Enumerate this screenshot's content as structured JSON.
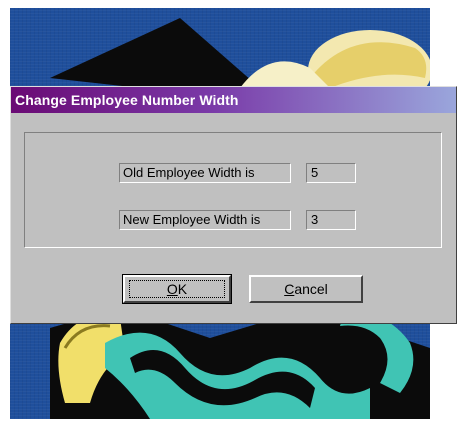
{
  "dialog": {
    "title": "Change Employee Number Width",
    "old_label": "Old Employee Width is",
    "old_value": "5",
    "new_label": "New Employee Width is",
    "new_value": "3",
    "ok_mnemonic": "O",
    "ok_rest": "K",
    "cancel_mnemonic": "C",
    "cancel_rest": "ancel"
  },
  "colors": {
    "desktop": "#1f4f9c",
    "titlebar_start": "#6a0a74",
    "titlebar_end": "#9aa6dc",
    "dialog_face": "#c0c0c0"
  }
}
